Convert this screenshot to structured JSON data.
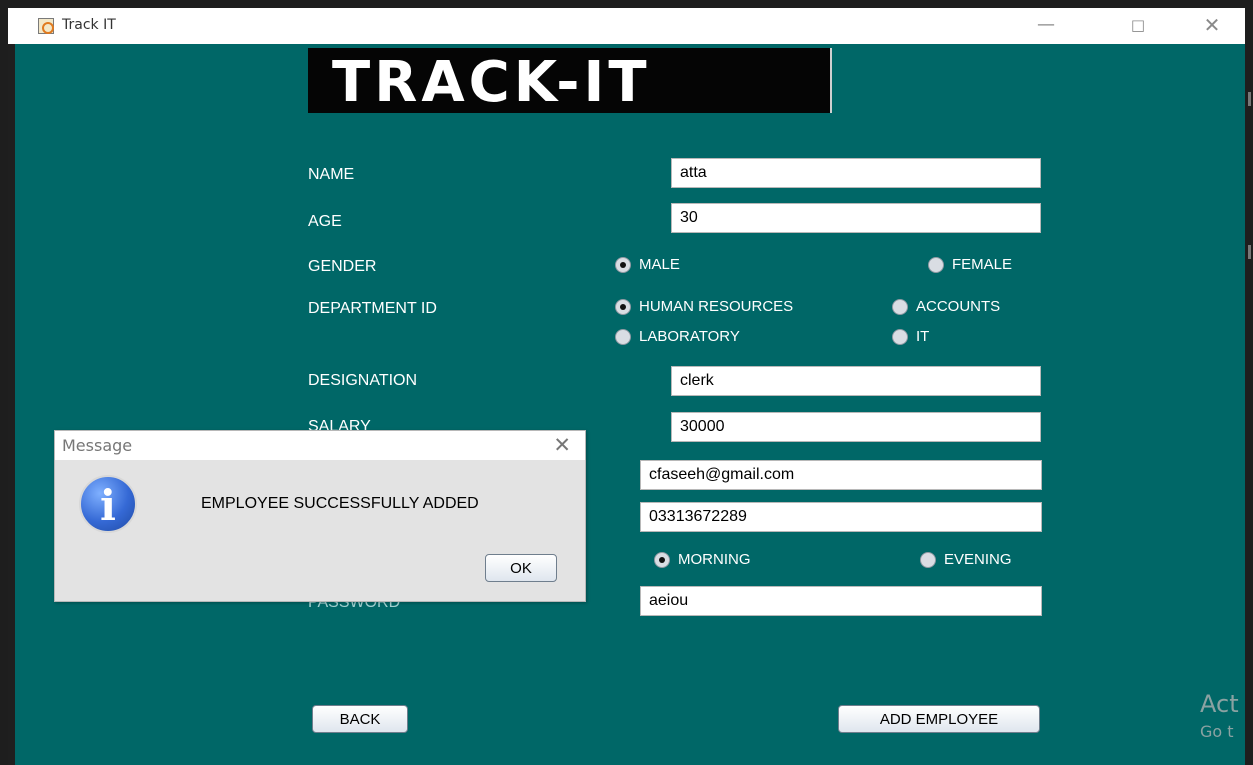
{
  "window": {
    "title": "Track IT",
    "controls": {
      "minimize": "—",
      "maximize": "□",
      "close": "✕"
    },
    "background": "#006767"
  },
  "logo": {
    "text": "TRACK-IT"
  },
  "form": {
    "name": {
      "label": "NAME",
      "value": "atta"
    },
    "age": {
      "label": "AGE",
      "value": "30"
    },
    "gender": {
      "label": "GENDER",
      "options": [
        {
          "label": "MALE",
          "selected": true
        },
        {
          "label": "FEMALE",
          "selected": false
        }
      ]
    },
    "department": {
      "label": "DEPARTMENT ID",
      "options": [
        {
          "label": "HUMAN RESOURCES",
          "selected": true
        },
        {
          "label": "ACCOUNTS",
          "selected": false
        },
        {
          "label": "LABORATORY",
          "selected": false
        },
        {
          "label": "IT",
          "selected": false
        }
      ]
    },
    "designation": {
      "label": "DESIGNATION",
      "value": "clerk"
    },
    "salary": {
      "label": "SALARY",
      "value": "30000"
    },
    "email": {
      "value": "cfaseeh@gmail.com"
    },
    "phone": {
      "value": "03313672289"
    },
    "shift": {
      "options": [
        {
          "label": "MORNING",
          "selected": true
        },
        {
          "label": "EVENING",
          "selected": false
        }
      ]
    },
    "password": {
      "label": "PASSWORD",
      "value": "aeiou"
    }
  },
  "buttons": {
    "back": "BACK",
    "add_employee": "ADD EMPLOYEE"
  },
  "dialog": {
    "title": "Message",
    "close": "✕",
    "icon": "i",
    "message": "EMPLOYEE SUCCESSFULLY ADDED",
    "ok_label": "OK"
  },
  "windows_activation": {
    "line1": "Act",
    "line2": "Go t"
  }
}
